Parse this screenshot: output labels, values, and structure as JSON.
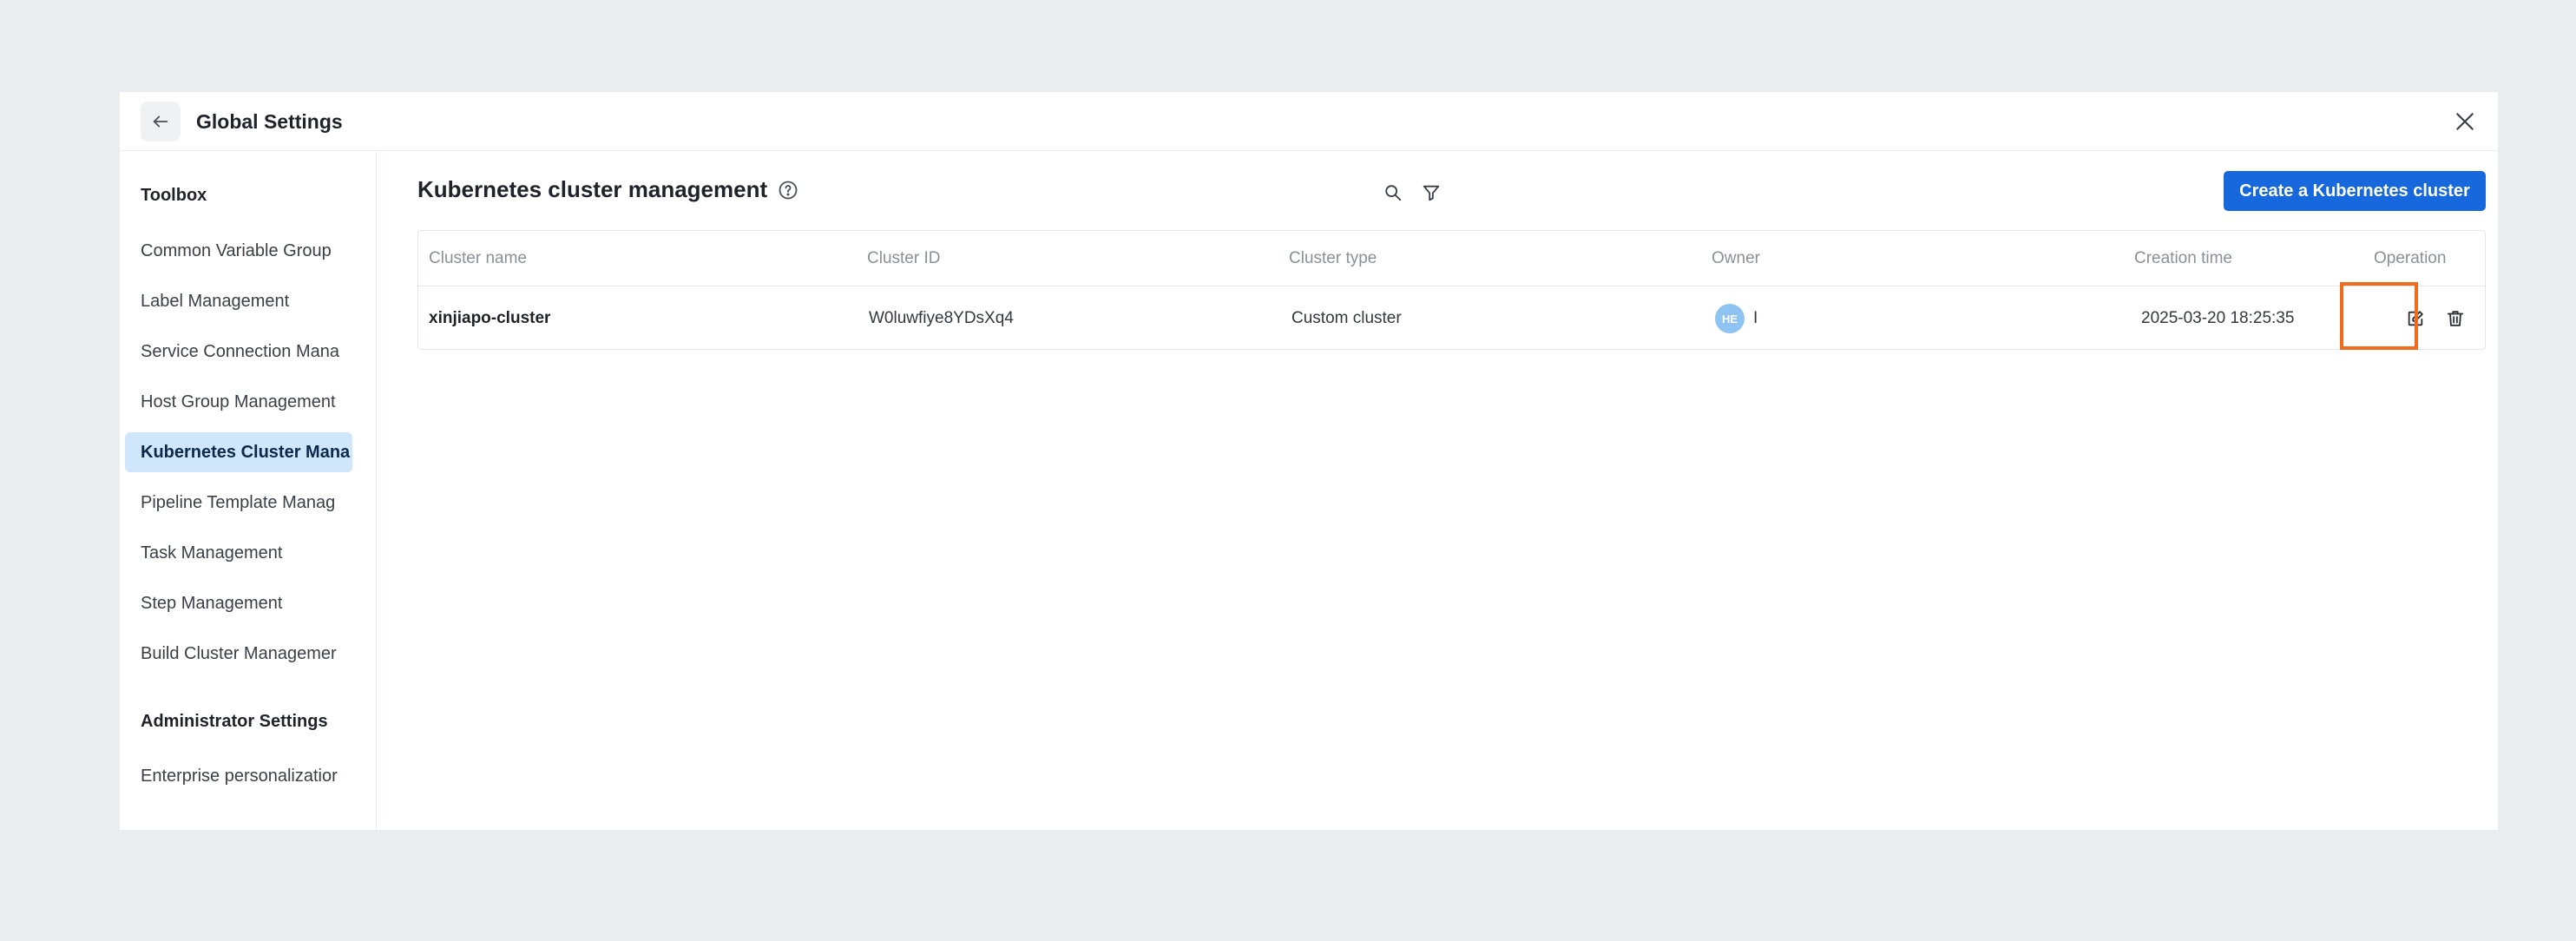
{
  "window": {
    "title": "Global Settings"
  },
  "sidebar": {
    "toolbox_title": "Toolbox",
    "items": [
      {
        "label": "Common Variable Group"
      },
      {
        "label": "Label Management"
      },
      {
        "label": "Service Connection Mana"
      },
      {
        "label": "Host Group Management"
      },
      {
        "label": "Kubernetes Cluster Mana",
        "active": true
      },
      {
        "label": "Pipeline Template Manag"
      },
      {
        "label": "Task Management"
      },
      {
        "label": "Step Management"
      },
      {
        "label": "Build Cluster Managemer"
      }
    ],
    "admin_title": "Administrator Settings",
    "admin_items": [
      {
        "label": "Enterprise personalizatior"
      }
    ]
  },
  "main": {
    "page_title": "Kubernetes cluster management",
    "create_button_label": "Create a Kubernetes cluster",
    "table": {
      "columns": [
        "Cluster name",
        "Cluster ID",
        "Cluster type",
        "Owner",
        "Creation time",
        "Operation"
      ],
      "rows": [
        {
          "cluster_name": "xinjiapo-cluster",
          "cluster_id": "W0luwfiye8YDsXq4",
          "cluster_type": "Custom cluster",
          "owner_avatar": "HE",
          "owner_name": "I",
          "creation_time": "2025-03-20 18:25:35"
        }
      ]
    }
  },
  "colors": {
    "primary": "#1668dc",
    "active_nav_bg": "#cfe6fb",
    "highlight": "#f26a1b",
    "background": "#e9edf0"
  },
  "icons": {
    "back": "arrow-left-icon",
    "close": "close-icon",
    "help": "question-circle-icon",
    "search": "search-icon",
    "filter": "filter-icon",
    "edit": "edit-icon",
    "delete": "trash-icon"
  }
}
